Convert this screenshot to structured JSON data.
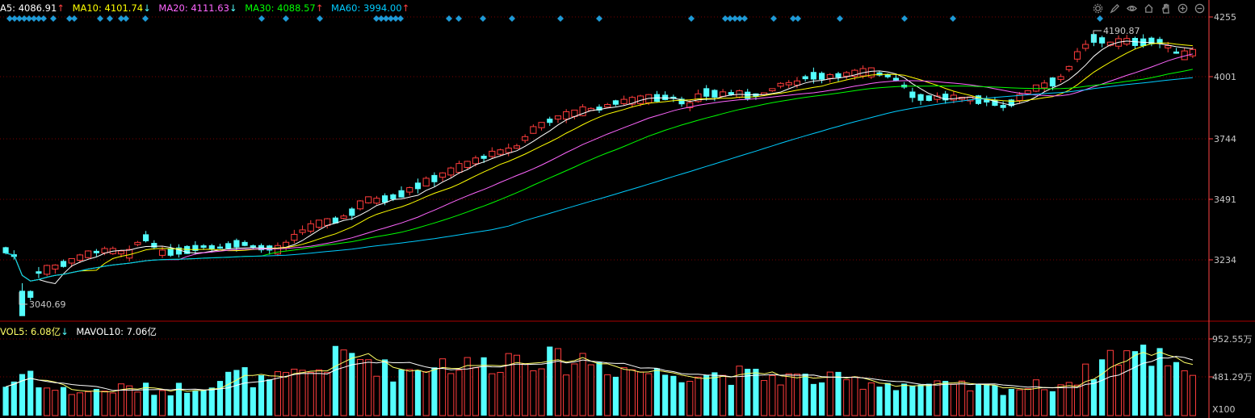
{
  "legend": {
    "ma5": {
      "text": "A5: 4086.91",
      "arrow": "↑",
      "color": "#ffffff"
    },
    "ma10": {
      "text": "MA10: 4101.74",
      "arrow": "↓",
      "color": "#ffff00"
    },
    "ma20": {
      "text": "MA20: 4111.63",
      "arrow": "↓",
      "color": "#ff66ff"
    },
    "ma30": {
      "text": "MA30: 4088.57",
      "arrow": "↑",
      "color": "#00ff00"
    },
    "ma60": {
      "text": "MA60: 3994.00",
      "arrow": "↑",
      "color": "#00ccff"
    }
  },
  "vol_legend": {
    "vol5": {
      "text": "VOL5: 6.08亿",
      "arrow": "↓",
      "color": "#ffff66"
    },
    "mavol10": {
      "text": "MAVOL10: 7.06亿",
      "arrow": "",
      "color": "#ffffff"
    }
  },
  "toolbar_icons": [
    "settings-icon",
    "pen-icon",
    "eye-icon",
    "home-icon",
    "hand-icon",
    "zoom-in-icon",
    "zoom-out-icon"
  ],
  "colors": {
    "up": "#ff3c3c",
    "down": "#54ffff",
    "grid": "#7a0000",
    "axis": "#ff4444",
    "marker": "#1e9ad6"
  },
  "chart_data": {
    "type": "candlestick",
    "price_axis": {
      "ticks": [
        "4255",
        "4001",
        "3744",
        "3491",
        "3234"
      ],
      "range": [
        3040,
        4260
      ]
    },
    "volume_axis": {
      "ticks": [
        "952.55万",
        "481.29万"
      ],
      "unit_label": "X100"
    },
    "annotations": {
      "high": "4190.87",
      "low": "3040.69"
    },
    "candle_count": 145,
    "price_keyframes": [
      [
        0,
        3320
      ],
      [
        3,
        3290
      ],
      [
        5,
        3080
      ],
      [
        8,
        3230
      ],
      [
        12,
        3250
      ],
      [
        18,
        3285
      ],
      [
        22,
        3310
      ],
      [
        26,
        3320
      ],
      [
        32,
        3305
      ],
      [
        35,
        3380
      ],
      [
        40,
        3310
      ],
      [
        46,
        3320
      ],
      [
        50,
        3335
      ],
      [
        55,
        3330
      ],
      [
        60,
        3350
      ],
      [
        64,
        3330
      ],
      [
        67,
        3330
      ],
      [
        70,
        3320
      ],
      [
        75,
        3390
      ],
      [
        80,
        3425
      ],
      [
        85,
        3440
      ],
      [
        88,
        3465
      ],
      [
        92,
        3520
      ],
      [
        95,
        3515
      ],
      [
        100,
        3535
      ],
      [
        106,
        3580
      ],
      [
        112,
        3620
      ],
      [
        118,
        3660
      ],
      [
        124,
        3700
      ],
      [
        130,
        3720
      ],
      [
        135,
        3800
      ],
      [
        140,
        3840
      ],
      [
        145,
        3860
      ],
      [
        149,
        3875
      ],
      [
        152,
        3880
      ],
      [
        156,
        3905
      ],
      [
        160,
        3910
      ],
      [
        165,
        3920
      ],
      [
        170,
        3925
      ],
      [
        175,
        3890
      ],
      [
        178,
        3945
      ],
      [
        182,
        3935
      ],
      [
        186,
        3940
      ],
      [
        190,
        3930
      ],
      [
        194,
        3938
      ],
      [
        198,
        3975
      ],
      [
        202,
        3980
      ],
      [
        205,
        4010
      ],
      [
        210,
        4005
      ],
      [
        215,
        4015
      ],
      [
        220,
        4025
      ],
      [
        225,
        4010
      ],
      [
        228,
        3990
      ],
      [
        232,
        3925
      ],
      [
        236,
        3920
      ],
      [
        240,
        3925
      ],
      [
        244,
        3920
      ],
      [
        248,
        3915
      ],
      [
        252,
        3905
      ],
      [
        255,
        3885
      ],
      [
        258,
        3915
      ],
      [
        262,
        3955
      ],
      [
        266,
        3975
      ],
      [
        270,
        4005
      ],
      [
        274,
        4100
      ],
      [
        278,
        4160
      ],
      [
        282,
        4135
      ],
      [
        286,
        4145
      ],
      [
        290,
        4140
      ],
      [
        294,
        4150
      ],
      [
        298,
        4110
      ],
      [
        300,
        4085
      ],
      [
        303,
        4100
      ]
    ],
    "volume_keyframes": [
      [
        0,
        0.35
      ],
      [
        6,
        0.55
      ],
      [
        10,
        0.32
      ],
      [
        18,
        0.28
      ],
      [
        26,
        0.3
      ],
      [
        32,
        0.33
      ],
      [
        40,
        0.3
      ],
      [
        48,
        0.35
      ],
      [
        54,
        0.42
      ],
      [
        60,
        0.5
      ],
      [
        66,
        0.38
      ],
      [
        72,
        0.45
      ],
      [
        80,
        0.55
      ],
      [
        86,
        0.72
      ],
      [
        92,
        0.68
      ],
      [
        98,
        0.52
      ],
      [
        104,
        0.55
      ],
      [
        110,
        0.65
      ],
      [
        116,
        0.58
      ],
      [
        124,
        0.62
      ],
      [
        130,
        0.72
      ],
      [
        136,
        0.7
      ],
      [
        142,
        0.62
      ],
      [
        148,
        0.68
      ],
      [
        154,
        0.58
      ],
      [
        160,
        0.55
      ],
      [
        166,
        0.5
      ],
      [
        172,
        0.52
      ],
      [
        178,
        0.5
      ],
      [
        186,
        0.48
      ],
      [
        194,
        0.46
      ],
      [
        200,
        0.45
      ],
      [
        210,
        0.42
      ],
      [
        220,
        0.4
      ],
      [
        228,
        0.38
      ],
      [
        236,
        0.35
      ],
      [
        244,
        0.33
      ],
      [
        252,
        0.32
      ],
      [
        260,
        0.33
      ],
      [
        270,
        0.38
      ],
      [
        276,
        0.5
      ],
      [
        282,
        0.72
      ],
      [
        288,
        0.75
      ],
      [
        292,
        0.7
      ],
      [
        296,
        0.72
      ],
      [
        302,
        0.55
      ],
      [
        305,
        0.5
      ]
    ]
  }
}
